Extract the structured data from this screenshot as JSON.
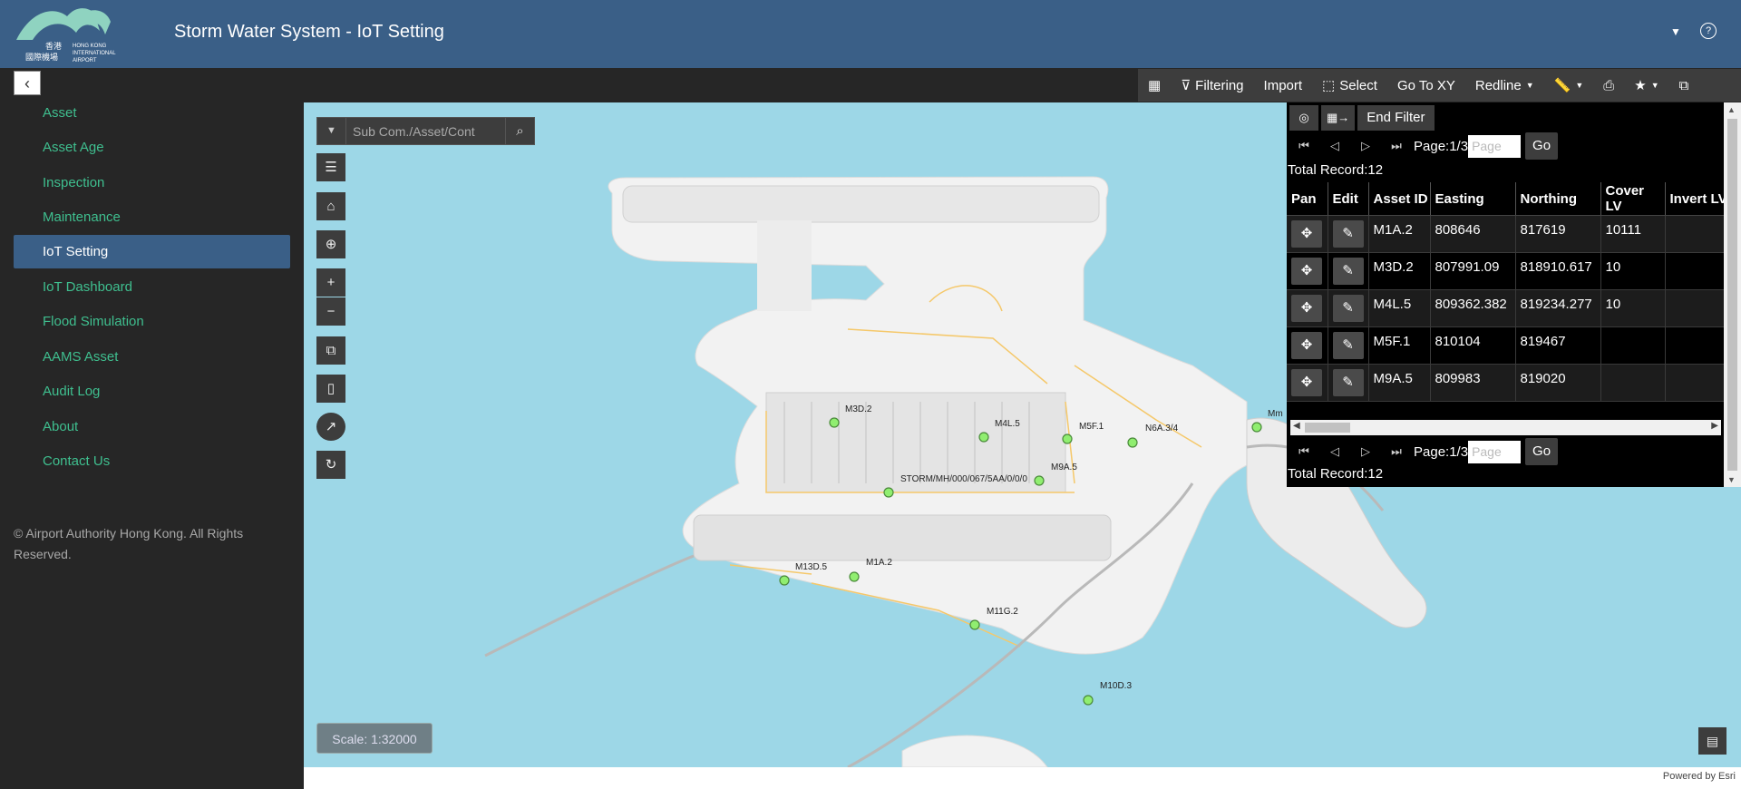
{
  "header": {
    "logo_text": "HONG KONG INTERNATIONAL AIRPORT",
    "logo_chinese": "香港國際機場",
    "title": "Storm Water System  -  IoT Setting",
    "caret_icon": "caret-down-icon",
    "help_icon": "question-circle-icon"
  },
  "toolbar": {
    "items": [
      {
        "icon": "table-icon",
        "label": ""
      },
      {
        "icon": "filter-icon",
        "label": "Filtering"
      },
      {
        "icon": "",
        "label": "Import"
      },
      {
        "icon": "select-icon",
        "label": "Select"
      },
      {
        "icon": "",
        "label": "Go To XY"
      },
      {
        "icon": "",
        "label": "Redline"
      },
      {
        "icon": "measure-icon",
        "label": ""
      },
      {
        "icon": "print-icon",
        "label": ""
      },
      {
        "icon": "star-icon",
        "label": ""
      },
      {
        "icon": "map-export-icon",
        "label": ""
      }
    ]
  },
  "sidebar": {
    "items": [
      {
        "label": "Asset",
        "active": false
      },
      {
        "label": "Asset Age",
        "active": false
      },
      {
        "label": "Inspection",
        "active": false
      },
      {
        "label": "Maintenance",
        "active": false
      },
      {
        "label": "IoT Setting",
        "active": true
      },
      {
        "label": "IoT Dashboard",
        "active": false
      },
      {
        "label": "Flood Simulation",
        "active": false
      },
      {
        "label": "AAMS Asset",
        "active": false
      },
      {
        "label": "Audit Log",
        "active": false
      },
      {
        "label": "About",
        "active": false
      },
      {
        "label": "Contact Us",
        "active": false
      }
    ],
    "copyright": "© Airport Authority Hong Kong. All Rights Reserved."
  },
  "map": {
    "search_placeholder": "Sub Com./Asset/Cont",
    "scale": "Scale: 1:32000",
    "powered_by": "Powered by Esri",
    "labels": [
      "M3D.2",
      "M4L.5",
      "M5F.1",
      "N6A.3/4",
      "M9A.5",
      "STORM/MH/000/067/5AA/0/0/0",
      "M1A.2",
      "M13D.5",
      "M11G.2",
      "M10D.3",
      "Mm"
    ]
  },
  "panel": {
    "end_filter": "End Filter",
    "page_label": "Page:1/3",
    "page_placeholder": "Page",
    "go": "Go",
    "total": "Total Record:12",
    "columns": [
      "Pan",
      "Edit",
      "Asset ID",
      "Easting",
      "Northing",
      "Cover LV",
      "Invert LV"
    ],
    "rows": [
      {
        "asset_id": "M1A.2",
        "easting": "808646",
        "northing": "817619",
        "cover_lv": "10111",
        "invert_lv": ""
      },
      {
        "asset_id": "M3D.2",
        "easting": "807991.09",
        "northing": "818910.617",
        "cover_lv": "10",
        "invert_lv": ""
      },
      {
        "asset_id": "M4L.5",
        "easting": "809362.382",
        "northing": "819234.277",
        "cover_lv": "10",
        "invert_lv": ""
      },
      {
        "asset_id": "M5F.1",
        "easting": "810104",
        "northing": "819467",
        "cover_lv": "",
        "invert_lv": ""
      },
      {
        "asset_id": "M9A.5",
        "easting": "809983",
        "northing": "819020",
        "cover_lv": "",
        "invert_lv": ""
      }
    ]
  },
  "colors": {
    "header": "#3a5f87",
    "nav_text": "#3fbf8f",
    "water": "#9dd7e7",
    "land": "#f2f2f2",
    "marker": "#90ee70"
  }
}
